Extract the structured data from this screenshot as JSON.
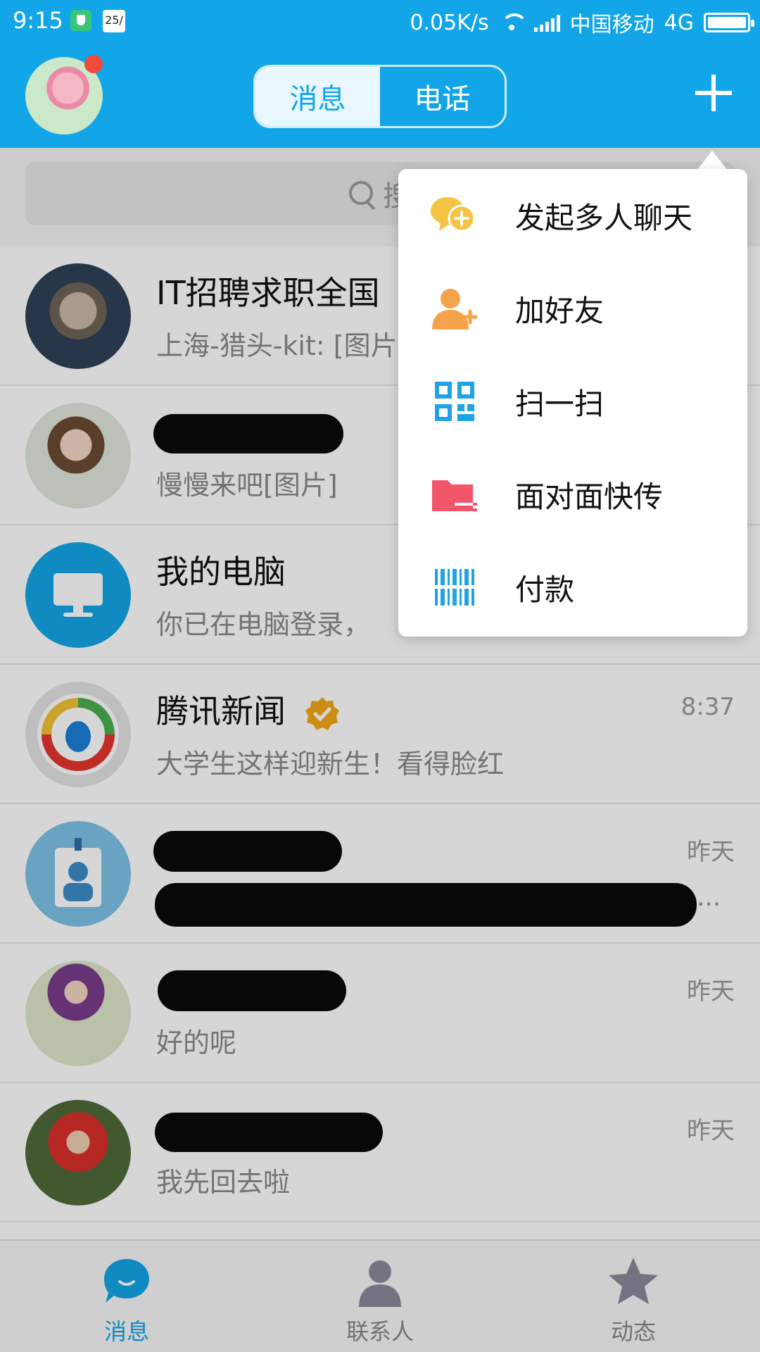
{
  "status_bar": {
    "time": "9:15",
    "calendar_badge": "25/",
    "speed": "0.05K/s",
    "carrier": "中国移动",
    "network": "4G",
    "battery_level": 0.95
  },
  "header": {
    "tabs": [
      {
        "label": "消息",
        "active": true
      },
      {
        "label": "电话",
        "active": false
      }
    ],
    "add_icon": "plus-icon"
  },
  "search": {
    "placeholder": "搜"
  },
  "chats": [
    {
      "name": "IT招聘求职全国",
      "message": "上海-猎头-kit: [图片",
      "time": ""
    },
    {
      "name": "",
      "message": "慢慢来吧[图片]",
      "time": "",
      "redacted_name": true
    },
    {
      "name": "我的电脑",
      "message": "你已在电脑登录，",
      "time": ""
    },
    {
      "name": "腾讯新闻",
      "message": "大学生这样迎新生！看得脸红",
      "time": "8:37",
      "verified": true
    },
    {
      "name": "",
      "message": "",
      "time": "昨天",
      "redacted_name": true,
      "redacted_message": true,
      "message_suffix": "..."
    },
    {
      "name": "",
      "message": "好的呢",
      "time": "昨天",
      "redacted_name": true
    },
    {
      "name": "",
      "message": "我先回去啦",
      "time": "昨天",
      "redacted_name": true
    }
  ],
  "popup_menu": [
    {
      "label": "发起多人聊天",
      "icon": "group-chat-icon",
      "color": "#f6c443"
    },
    {
      "label": "加好友",
      "icon": "add-friend-icon",
      "color": "#f5a34a"
    },
    {
      "label": "扫一扫",
      "icon": "scan-qr-icon",
      "color": "#1fa3e6"
    },
    {
      "label": "面对面快传",
      "icon": "face-transfer-icon",
      "color": "#f0556a"
    },
    {
      "label": "付款",
      "icon": "barcode-pay-icon",
      "color": "#1fa3e6"
    }
  ],
  "bottom_nav": [
    {
      "label": "消息",
      "icon": "message-bubble-icon",
      "active": true
    },
    {
      "label": "联系人",
      "icon": "contact-person-icon",
      "active": false
    },
    {
      "label": "动态",
      "icon": "star-icon",
      "active": false
    }
  ],
  "colors": {
    "brand": "#12a6e8",
    "dot": "#f04a3c"
  }
}
